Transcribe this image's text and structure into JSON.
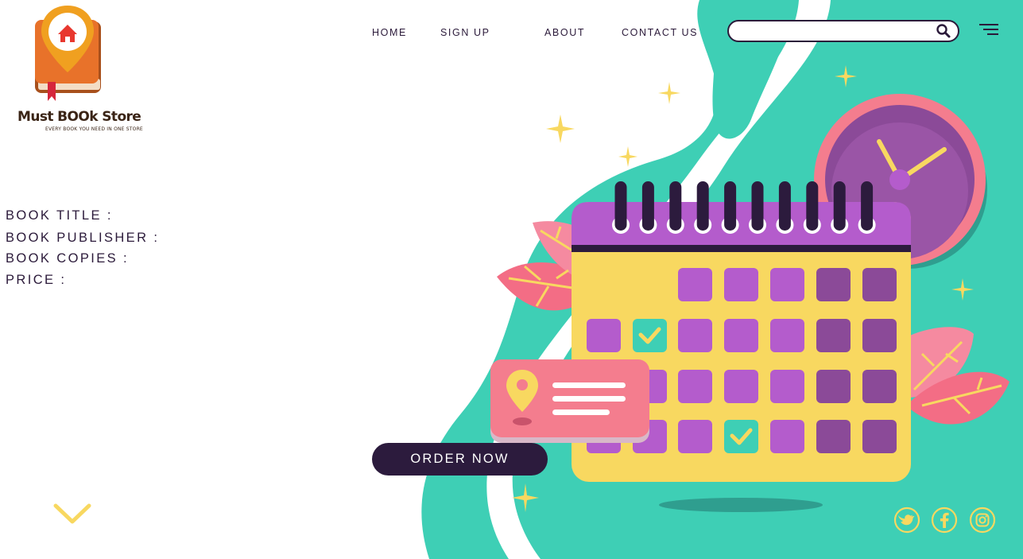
{
  "brand": {
    "name": "Must BOOk Store",
    "tagline": "EVERY BOOK YOU NEED IN ONE STORE"
  },
  "nav": {
    "items": [
      {
        "label": "HOME"
      },
      {
        "label": "SIGN UP"
      },
      {
        "label": "ABOUT"
      },
      {
        "label": "CONTACT US"
      }
    ]
  },
  "search": {
    "value": "",
    "placeholder": ""
  },
  "book_info": {
    "title_label": "BOOK TITLE :",
    "publisher_label": "BOOK PUBLISHER :",
    "copies_label": "BOOK COPIES :",
    "price_label": "PRICE :"
  },
  "cta": {
    "order_label": "ORDER NOW"
  },
  "icons": {
    "search": "search-icon",
    "menu": "hamburger-menu-icon",
    "scroll": "chevron-down-icon",
    "social": [
      "twitter-icon",
      "facebook-icon",
      "instagram-icon"
    ]
  },
  "colors": {
    "teal": "#3ecfb5",
    "purple": "#b45ccc",
    "dark_purple": "#8b4a98",
    "navy": "#2c1b3d",
    "yellow": "#f8d860",
    "pink": "#f47d8e",
    "orange": "#e8722a"
  }
}
